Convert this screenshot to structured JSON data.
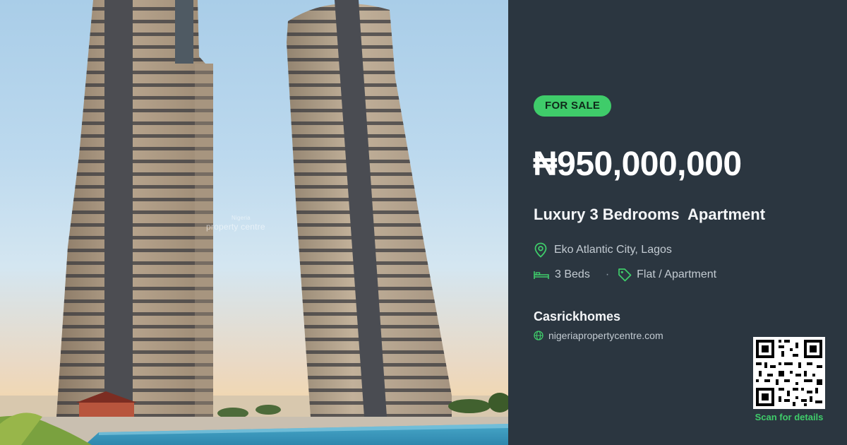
{
  "photo": {
    "watermark_top": "Nigeria",
    "watermark_brand": "property centre"
  },
  "listing": {
    "status": "FOR SALE",
    "price": "₦950,000,000",
    "title": "Luxury 3 Bedrooms  Apartment",
    "location": "Eko Atlantic City, Lagos",
    "beds": "3 Beds",
    "separator": "·",
    "property_type": "Flat / Apartment"
  },
  "agent": {
    "name": "Casrickhomes",
    "website": "nigeriapropertycentre.com"
  },
  "qr": {
    "caption": "Scan for details"
  },
  "colors": {
    "panel_bg": "#2b3640",
    "accent_green": "#3fcc6a",
    "text_primary": "#ffffff",
    "text_secondary": "#c3cbd2"
  },
  "icons": {
    "location": "map-pin-icon",
    "beds": "bed-icon",
    "type": "tag-icon",
    "website": "globe-icon"
  }
}
